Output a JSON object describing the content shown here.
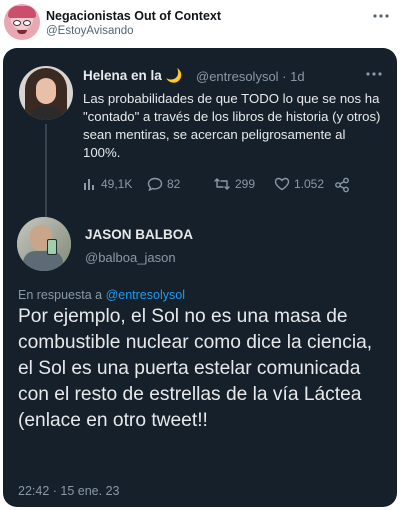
{
  "outer_tweet": {
    "author_name": "Negacionistas Out of Context",
    "author_handle": "@EstoyAvisando",
    "more_icon": "ellipsis-icon"
  },
  "quoted_thread": {
    "first_tweet": {
      "author_name": "Helena en la 🌙",
      "author_handle": "@entresolysol · 1d",
      "text": "Las probabilidades de que TODO lo que se nos ha \"contado\" a través de los libros de historia (y otros) sean mentiras, se acercan peligrosamente al 100%.",
      "stats": {
        "views": "49,1K",
        "replies": "82",
        "retweets": "299",
        "likes": "1.052"
      }
    },
    "reply_tweet": {
      "author_name": "JASON BALBOA",
      "author_handle": "@balboa_jason",
      "reply_prefix": "En respuesta a",
      "reply_mention": "@entresolysol",
      "text": "Por ejemplo, el Sol no es una masa de combustible nuclear como dice la ciencia, el Sol es una puerta estelar comunicada con el resto de estrellas de la vía Láctea (enlace en otro tweet!!",
      "timestamp": "22:42 · 15 ene. 23"
    }
  },
  "colors": {
    "card_background": "#15202b",
    "primary_text": "#e7e9ea",
    "secondary_text": "#8b98a5",
    "link": "#1d9bf0"
  }
}
